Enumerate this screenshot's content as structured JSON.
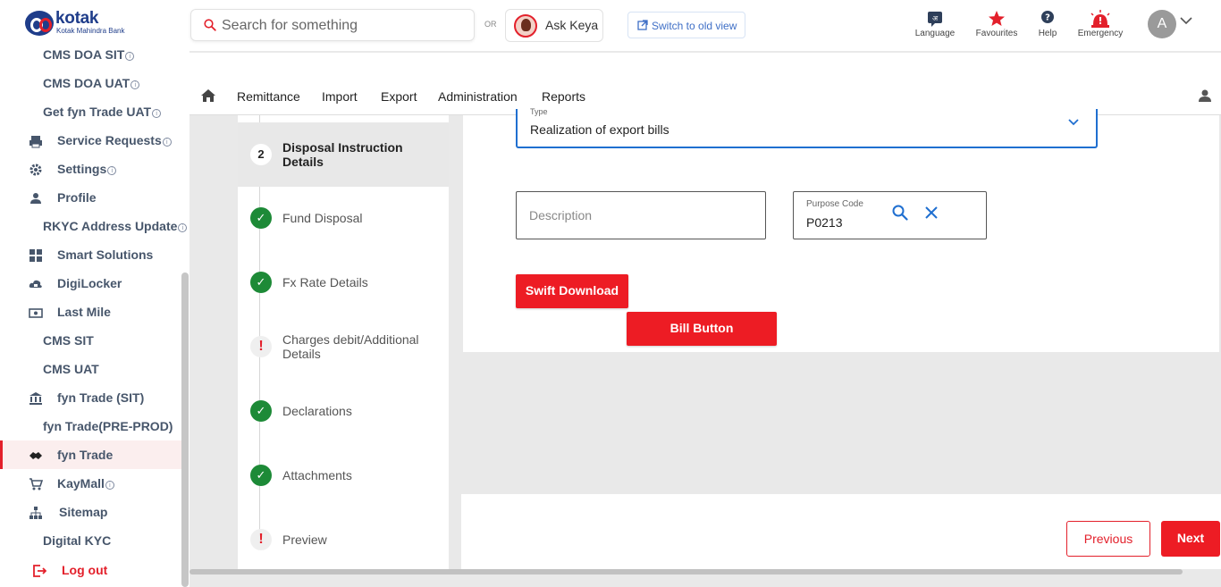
{
  "header": {
    "brand": "kotak",
    "brand_sub": "Kotak Mahindra Bank",
    "search_placeholder": "Search for something",
    "or_label": "OR",
    "ask_keya": "Ask Keya",
    "switch_view": "Switch to old view",
    "icons": [
      {
        "name": "language-icon",
        "label": "Language"
      },
      {
        "name": "favourites-icon",
        "label": "Favourites"
      },
      {
        "name": "help-icon",
        "label": "Help"
      },
      {
        "name": "emergency-icon",
        "label": "Emergency"
      }
    ],
    "avatar_initial": "A",
    "colors": {
      "accent": "#ed1c24",
      "brand_blue": "#1f3d8a",
      "success": "#1d8a37",
      "focus": "#1f6fd0"
    }
  },
  "sidebar": {
    "items": [
      {
        "label": "CMS DOA SIT",
        "info": true,
        "icon": "",
        "active": false
      },
      {
        "label": "CMS DOA UAT",
        "info": true,
        "icon": "",
        "active": false
      },
      {
        "label": "Get fyn Trade UAT",
        "info": true,
        "icon": "",
        "active": false
      },
      {
        "label": "Service Requests",
        "info": true,
        "icon": "printer-icon",
        "active": false
      },
      {
        "label": "Settings",
        "info": true,
        "icon": "gear-icon",
        "active": false
      },
      {
        "label": "Profile",
        "info": false,
        "icon": "person-icon",
        "active": false
      },
      {
        "label": "RKYC Address Update",
        "info": true,
        "icon": "",
        "active": false
      },
      {
        "label": "Smart Solutions",
        "info": false,
        "icon": "grid-icon",
        "active": false
      },
      {
        "label": "DigiLocker",
        "info": false,
        "icon": "cloud-lock-icon",
        "active": false
      },
      {
        "label": "Last Mile",
        "info": false,
        "icon": "cash-icon",
        "active": false
      },
      {
        "label": "CMS SIT",
        "info": false,
        "icon": "",
        "active": false
      },
      {
        "label": "CMS UAT",
        "info": false,
        "icon": "",
        "active": false
      },
      {
        "label": "fyn Trade (SIT)",
        "info": false,
        "icon": "bank-icon",
        "active": false
      },
      {
        "label": "fyn Trade(PRE-PROD)",
        "info": false,
        "icon": "",
        "active": false
      },
      {
        "label": "fyn Trade",
        "info": false,
        "icon": "handshake-icon",
        "active": true
      },
      {
        "label": "KayMall",
        "info": true,
        "icon": "cart-icon",
        "active": false
      },
      {
        "label": "Sitemap",
        "info": false,
        "icon": "sitemap-icon",
        "active": false
      },
      {
        "label": "Digital KYC",
        "info": false,
        "icon": "",
        "active": false
      },
      {
        "label": "Log out",
        "info": false,
        "icon": "logout-icon",
        "active": false
      }
    ],
    "info_glyph": "i"
  },
  "menu": {
    "items": [
      "Remittance",
      "Import",
      "Export",
      "Administration",
      "Reports"
    ]
  },
  "steps": [
    {
      "badge": "2",
      "state": "num",
      "label": "Disposal Instruction Details",
      "active": true
    },
    {
      "badge": "✓",
      "state": "ok",
      "label": "Fund Disposal",
      "active": false
    },
    {
      "badge": "✓",
      "state": "ok",
      "label": "Fx Rate Details",
      "active": false
    },
    {
      "badge": "!",
      "state": "warn",
      "label": "Charges debit/Additional Details",
      "active": false
    },
    {
      "badge": "✓",
      "state": "ok",
      "label": "Declarations",
      "active": false
    },
    {
      "badge": "✓",
      "state": "ok",
      "label": "Attachments",
      "active": false
    },
    {
      "badge": "!",
      "state": "warn",
      "label": "Preview",
      "active": false
    }
  ],
  "form": {
    "type_label": "Type",
    "type_value": "Realization of export bills",
    "description_placeholder": "Description",
    "purpose_label": "Purpose Code",
    "purpose_value": "P0213",
    "swift_download": "Swift Download",
    "bill_button": "Bill Button"
  },
  "footer": {
    "previous": "Previous",
    "next": "Next"
  }
}
